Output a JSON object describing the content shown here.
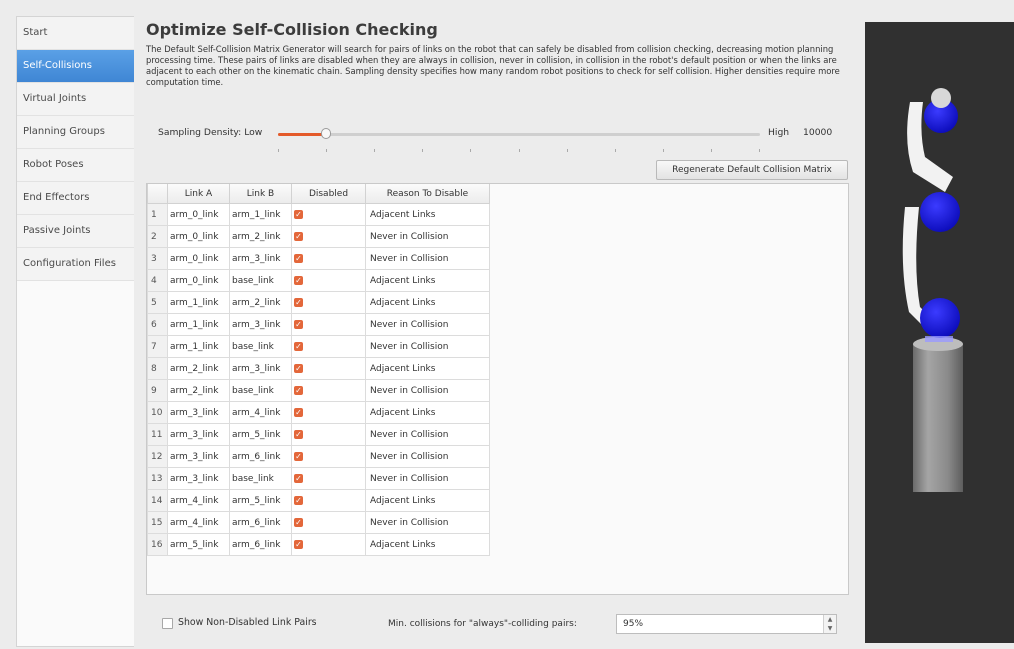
{
  "sidebar": {
    "items": [
      {
        "label": "Start",
        "active": false
      },
      {
        "label": "Self-Collisions",
        "active": true
      },
      {
        "label": "Virtual Joints",
        "active": false
      },
      {
        "label": "Planning Groups",
        "active": false
      },
      {
        "label": "Robot Poses",
        "active": false
      },
      {
        "label": "End Effectors",
        "active": false
      },
      {
        "label": "Passive Joints",
        "active": false
      },
      {
        "label": "Configuration Files",
        "active": false
      }
    ]
  },
  "main": {
    "title": "Optimize Self-Collision Checking",
    "description": "The Default Self-Collision Matrix Generator will search for pairs of links on the robot that can safely be disabled from collision checking, decreasing motion planning processing time. These pairs of links are disabled when they are always in collision, never in collision, in collision in the robot's default position or when the links are adjacent to each other on the kinematic chain. Sampling density specifies how many random robot positions to check for self collision. Higher densities require more computation time.",
    "density": {
      "label": "Sampling Density: Low",
      "high_label": "High",
      "value": "10000",
      "slider_fraction": 0.1
    },
    "regenerate_label": "Regenerate Default Collision Matrix",
    "table": {
      "headers": [
        "Link A",
        "Link B",
        "Disabled",
        "Reason To Disable"
      ],
      "rows": [
        {
          "index": "1",
          "link_a": "arm_0_link",
          "link_b": "arm_1_link",
          "disabled": true,
          "reason": "Adjacent Links"
        },
        {
          "index": "2",
          "link_a": "arm_0_link",
          "link_b": "arm_2_link",
          "disabled": true,
          "reason": "Never in Collision"
        },
        {
          "index": "3",
          "link_a": "arm_0_link",
          "link_b": "arm_3_link",
          "disabled": true,
          "reason": "Never in Collision"
        },
        {
          "index": "4",
          "link_a": "arm_0_link",
          "link_b": "base_link",
          "disabled": true,
          "reason": "Adjacent Links"
        },
        {
          "index": "5",
          "link_a": "arm_1_link",
          "link_b": "arm_2_link",
          "disabled": true,
          "reason": "Adjacent Links"
        },
        {
          "index": "6",
          "link_a": "arm_1_link",
          "link_b": "arm_3_link",
          "disabled": true,
          "reason": "Never in Collision"
        },
        {
          "index": "7",
          "link_a": "arm_1_link",
          "link_b": "base_link",
          "disabled": true,
          "reason": "Never in Collision"
        },
        {
          "index": "8",
          "link_a": "arm_2_link",
          "link_b": "arm_3_link",
          "disabled": true,
          "reason": "Adjacent Links"
        },
        {
          "index": "9",
          "link_a": "arm_2_link",
          "link_b": "base_link",
          "disabled": true,
          "reason": "Never in Collision"
        },
        {
          "index": "10",
          "link_a": "arm_3_link",
          "link_b": "arm_4_link",
          "disabled": true,
          "reason": "Adjacent Links"
        },
        {
          "index": "11",
          "link_a": "arm_3_link",
          "link_b": "arm_5_link",
          "disabled": true,
          "reason": "Never in Collision"
        },
        {
          "index": "12",
          "link_a": "arm_3_link",
          "link_b": "arm_6_link",
          "disabled": true,
          "reason": "Never in Collision"
        },
        {
          "index": "13",
          "link_a": "arm_3_link",
          "link_b": "base_link",
          "disabled": true,
          "reason": "Never in Collision"
        },
        {
          "index": "14",
          "link_a": "arm_4_link",
          "link_b": "arm_5_link",
          "disabled": true,
          "reason": "Adjacent Links"
        },
        {
          "index": "15",
          "link_a": "arm_4_link",
          "link_b": "arm_6_link",
          "disabled": true,
          "reason": "Never in Collision"
        },
        {
          "index": "16",
          "link_a": "arm_5_link",
          "link_b": "arm_6_link",
          "disabled": true,
          "reason": "Adjacent Links"
        }
      ]
    },
    "show_non_disabled": {
      "label": "Show Non-Disabled Link Pairs",
      "checked": false
    },
    "min_collisions": {
      "label": "Min. collisions for \"always\"-colliding pairs:",
      "value": "95%"
    }
  },
  "colors": {
    "accent": "#e45a2a",
    "selected_nav": "#4a90db",
    "viewport_bg": "#303030",
    "joint_blue": "#1a1ae0"
  }
}
